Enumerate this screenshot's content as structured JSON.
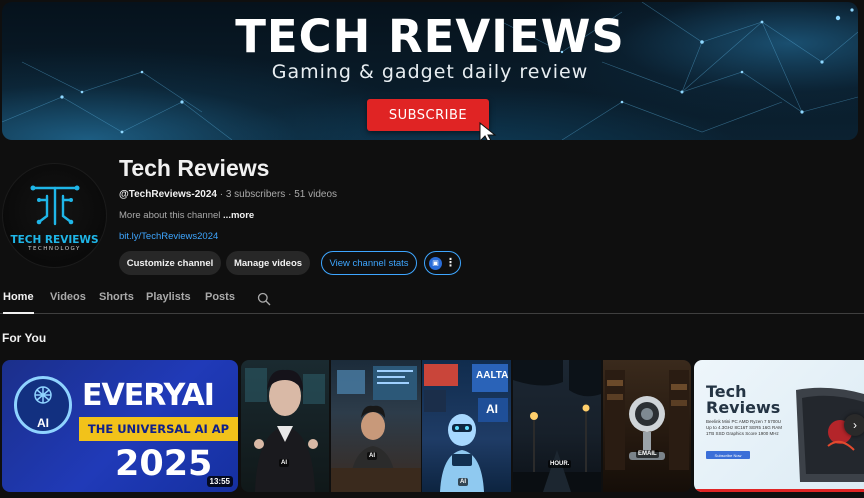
{
  "banner": {
    "title": "TECH REVIEWS",
    "tagline": "Gaming & gadget daily review",
    "subscribe_label": "SUBSCRIBE"
  },
  "channel": {
    "name": "Tech Reviews",
    "avatar_title": "TECH REVIEWS",
    "avatar_subtitle": "TECHNOLOGY",
    "handle": "@TechReviews-2024",
    "subscribers": "3 subscribers",
    "videos_count": "51 videos",
    "meta_sep": " · ",
    "description": "More about this channel",
    "more_label": "...more",
    "link": "bit.ly/TechReviews2024"
  },
  "actions": {
    "customize": "Customize channel",
    "manage": "Manage videos",
    "stats": "View channel stats",
    "more_icon": "more-vert-icon"
  },
  "tabs": [
    {
      "label": "Home",
      "active": true
    },
    {
      "label": "Videos",
      "active": false
    },
    {
      "label": "Shorts",
      "active": false
    },
    {
      "label": "Playlists",
      "active": false
    },
    {
      "label": "Posts",
      "active": false
    }
  ],
  "section": {
    "title": "For You"
  },
  "videos": {
    "v1": {
      "ai_label": "AI",
      "line1": "EVERYAI",
      "line2": "THE UNIVERSAL AI AP",
      "line3": "2025",
      "duration": "13:55"
    },
    "v2": {
      "tag": "AI"
    },
    "v3": {
      "tag": "AI"
    },
    "v4": {
      "brand": "AALTA",
      "ai": "AI",
      "tag": "AI"
    },
    "v5": {
      "tag": "HOUR."
    },
    "v6": {
      "tag": "EMAIL"
    },
    "v7": {
      "title_line1": "Tech",
      "title_line2": "Reviews",
      "specs": "Beelink Mini PC AMD Ryzen 7 5700U Up to 4.3GHz 8C16T SER5 16G RAM 1TB SSD Graphics Score 1900 MHz",
      "button": "Subscribe Now"
    }
  },
  "colors": {
    "accent": "#3ea6ff",
    "subscribe_red": "#e02424",
    "background": "#0f0f0f"
  }
}
